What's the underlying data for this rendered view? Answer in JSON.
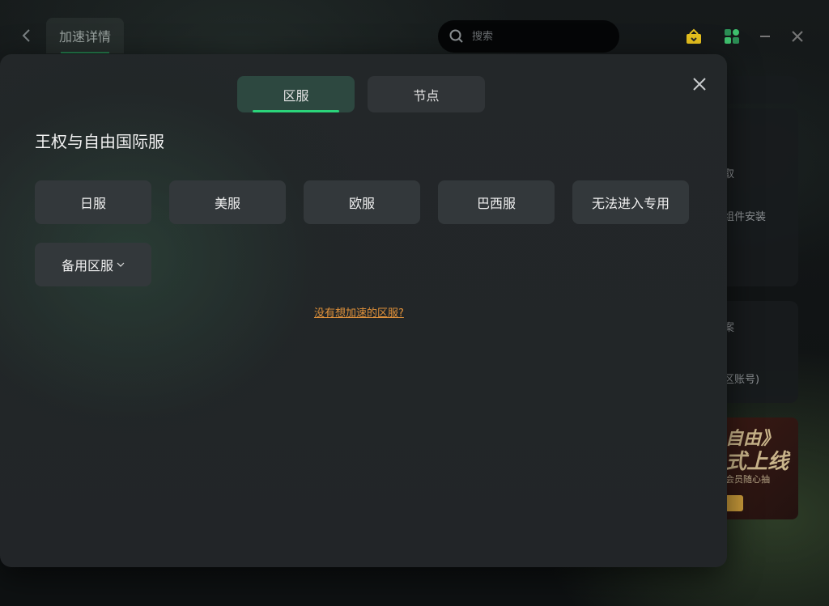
{
  "topbar": {
    "title": "加速详情",
    "search_placeholder": "搜索"
  },
  "side_cards": {
    "card1_lines": [
      "取",
      "组件安装"
    ],
    "card2_lines": [
      "案",
      "区账号)"
    ]
  },
  "promo": {
    "line1": "自由》",
    "line2": "式上线",
    "line3": "会员随心抽"
  },
  "modal": {
    "tabs": [
      {
        "label": "区服",
        "active": true
      },
      {
        "label": "节点",
        "active": false
      }
    ],
    "game_title": "王权与自由国际服",
    "regions": [
      "日服",
      "美服",
      "欧服",
      "巴西服",
      "无法进入专用"
    ],
    "backup_region": "备用区服",
    "help_link": "没有想加速的区服?"
  },
  "colors": {
    "accent": "#2bd47a",
    "link": "#e0913a",
    "modal_bg": "#222528",
    "chip_bg": "#33383b"
  }
}
